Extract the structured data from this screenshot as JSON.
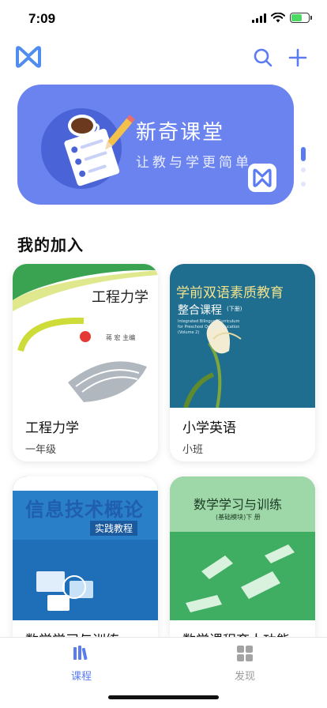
{
  "status_bar": {
    "time": "7:09"
  },
  "header": {
    "logo_icon": "app-logo-icon",
    "search_icon": "search-icon",
    "add_icon": "plus-icon"
  },
  "banner": {
    "title": "新奇课堂",
    "subtitle": "让教与学更简单",
    "illustration": "coffee-notebook-icon",
    "badge_icon": "app-logo-icon",
    "pager_count": 3,
    "pager_active": 0,
    "color": "#6a83ee"
  },
  "section_title": "我的加入",
  "courses": [
    {
      "title": "工程力学",
      "subtitle": "一年级",
      "cover": {
        "title": "工程力学",
        "author": "蒋 宏 主编"
      }
    },
    {
      "title": "小学英语",
      "subtitle": "小班",
      "cover": {
        "title": "学前双语素质教育",
        "subtitle": "整合课程",
        "volume": "(下册)",
        "english": "Integrated Bilingual Curriculum for Preschool Quality Education (Volume 2)"
      }
    },
    {
      "title": "数学学习与训练",
      "subtitle": "",
      "cover": {
        "title": "信息技术概论",
        "subtitle": "实践教程"
      }
    },
    {
      "title": "数学课程育人功能",
      "subtitle": "",
      "cover": {
        "title": "数学学习与训练",
        "subtitle": "(基础模块)下 册"
      }
    }
  ],
  "tabs": [
    {
      "label": "课程",
      "icon": "books-icon",
      "active": true
    },
    {
      "label": "发现",
      "icon": "grid-icon",
      "active": false
    }
  ],
  "colors": {
    "accent": "#5b7cf0",
    "tab_inactive": "#9a9a9a"
  }
}
